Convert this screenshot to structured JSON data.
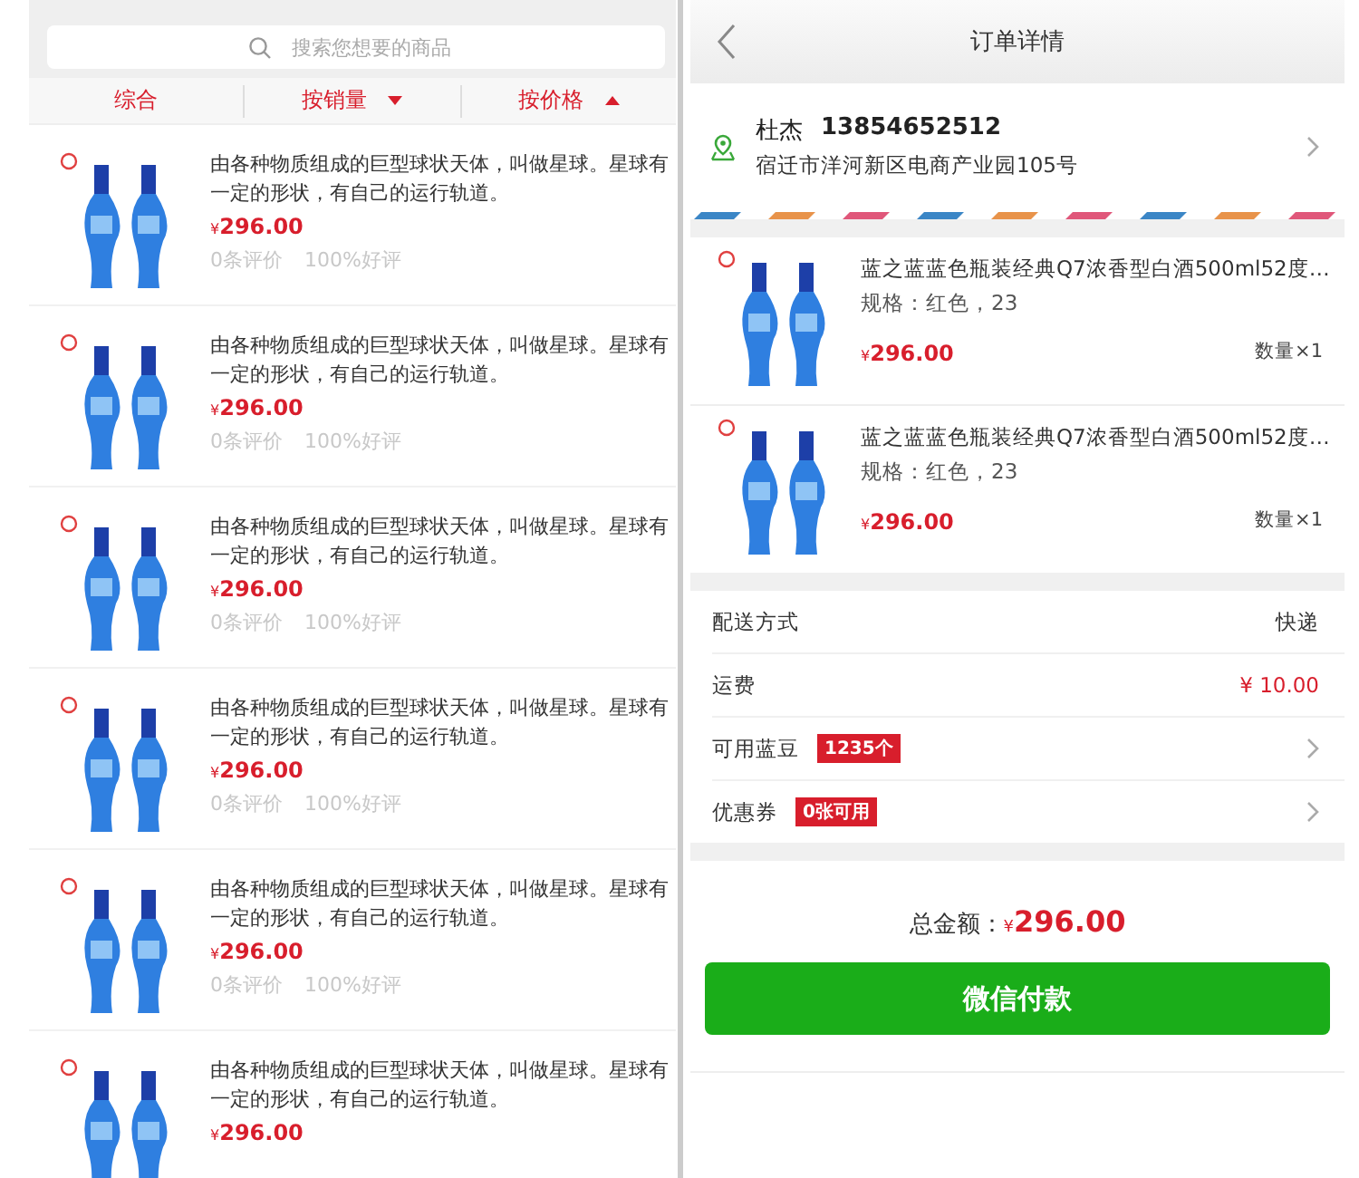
{
  "product_list": {
    "search": {
      "placeholder": "搜索您想要的商品"
    },
    "sort_tabs": [
      {
        "label": "综合",
        "kind": "plain"
      },
      {
        "label": "按销量",
        "kind": "descending"
      },
      {
        "label": "按价格",
        "kind": "ascending"
      }
    ],
    "products": [
      {
        "description": "由各种物质组成的巨型球状天体，叫做星球。星球有一定的形状，有自己的运行轨道。",
        "currency": "¥",
        "price": "296.00",
        "reviews": "0条评价",
        "rating": "100%好评"
      },
      {
        "description": "由各种物质组成的巨型球状天体，叫做星球。星球有一定的形状，有自己的运行轨道。",
        "currency": "¥",
        "price": "296.00",
        "reviews": "0条评价",
        "rating": "100%好评"
      },
      {
        "description": "由各种物质组成的巨型球状天体，叫做星球。星球有一定的形状，有自己的运行轨道。",
        "currency": "¥",
        "price": "296.00",
        "reviews": "0条评价",
        "rating": "100%好评"
      },
      {
        "description": "由各种物质组成的巨型球状天体，叫做星球。星球有一定的形状，有自己的运行轨道。",
        "currency": "¥",
        "price": "296.00",
        "reviews": "0条评价",
        "rating": "100%好评"
      },
      {
        "description": "由各种物质组成的巨型球状天体，叫做星球。星球有一定的形状，有自己的运行轨道。",
        "currency": "¥",
        "price": "296.00",
        "reviews": "0条评价",
        "rating": "100%好评"
      },
      {
        "description": "由各种物质组成的巨型球状天体，叫做星球。星球有一定的形状，有自己的运行轨道。",
        "currency": "¥",
        "price": "296.00"
      }
    ]
  },
  "order_detail": {
    "header": {
      "title": "订单详情"
    },
    "address": {
      "name": "杜杰",
      "phone": "13854652512",
      "address": "宿迁市洋河新区电商产业园105号"
    },
    "items": [
      {
        "title": "蓝之蓝蓝色瓶装经典Q7浓香型白酒500ml52度…",
        "spec": "规格：红色，23",
        "currency": "¥",
        "price": "296.00",
        "quantity": "数量×1"
      },
      {
        "title": "蓝之蓝蓝色瓶装经典Q7浓香型白酒500ml52度…",
        "spec": "规格：红色，23",
        "currency": "¥",
        "price": "296.00",
        "quantity": "数量×1"
      }
    ],
    "rows": [
      {
        "kind": "text",
        "label": "配送方式",
        "value": "快递",
        "chevron": false
      },
      {
        "kind": "price",
        "label": "运费",
        "value": "¥ 10.00",
        "chevron": false
      },
      {
        "kind": "badge",
        "label": "可用蓝豆",
        "value": "1235个",
        "chevron": true
      },
      {
        "kind": "badge",
        "label": "优惠券",
        "value": "0张可用",
        "chevron": true
      }
    ],
    "total": {
      "label": "总金额：",
      "currency": "¥",
      "amount": "296.00"
    },
    "pay_button": "微信付款"
  }
}
